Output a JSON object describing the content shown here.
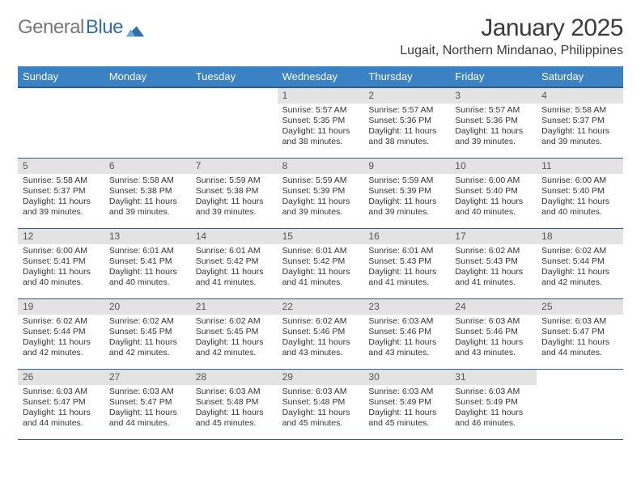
{
  "brand": {
    "general": "General",
    "blue": "Blue"
  },
  "title": "January 2025",
  "location": "Lugait, Northern Mindanao, Philippines",
  "weekdays": [
    "Sunday",
    "Monday",
    "Tuesday",
    "Wednesday",
    "Thursday",
    "Friday",
    "Saturday"
  ],
  "cells": [
    {
      "n": "",
      "s": "",
      "t": "",
      "d": ""
    },
    {
      "n": "",
      "s": "",
      "t": "",
      "d": ""
    },
    {
      "n": "",
      "s": "",
      "t": "",
      "d": ""
    },
    {
      "n": "1",
      "s": "Sunrise: 5:57 AM",
      "t": "Sunset: 5:35 PM",
      "d": "Daylight: 11 hours and 38 minutes."
    },
    {
      "n": "2",
      "s": "Sunrise: 5:57 AM",
      "t": "Sunset: 5:36 PM",
      "d": "Daylight: 11 hours and 38 minutes."
    },
    {
      "n": "3",
      "s": "Sunrise: 5:57 AM",
      "t": "Sunset: 5:36 PM",
      "d": "Daylight: 11 hours and 39 minutes."
    },
    {
      "n": "4",
      "s": "Sunrise: 5:58 AM",
      "t": "Sunset: 5:37 PM",
      "d": "Daylight: 11 hours and 39 minutes."
    },
    {
      "n": "5",
      "s": "Sunrise: 5:58 AM",
      "t": "Sunset: 5:37 PM",
      "d": "Daylight: 11 hours and 39 minutes."
    },
    {
      "n": "6",
      "s": "Sunrise: 5:58 AM",
      "t": "Sunset: 5:38 PM",
      "d": "Daylight: 11 hours and 39 minutes."
    },
    {
      "n": "7",
      "s": "Sunrise: 5:59 AM",
      "t": "Sunset: 5:38 PM",
      "d": "Daylight: 11 hours and 39 minutes."
    },
    {
      "n": "8",
      "s": "Sunrise: 5:59 AM",
      "t": "Sunset: 5:39 PM",
      "d": "Daylight: 11 hours and 39 minutes."
    },
    {
      "n": "9",
      "s": "Sunrise: 5:59 AM",
      "t": "Sunset: 5:39 PM",
      "d": "Daylight: 11 hours and 39 minutes."
    },
    {
      "n": "10",
      "s": "Sunrise: 6:00 AM",
      "t": "Sunset: 5:40 PM",
      "d": "Daylight: 11 hours and 40 minutes."
    },
    {
      "n": "11",
      "s": "Sunrise: 6:00 AM",
      "t": "Sunset: 5:40 PM",
      "d": "Daylight: 11 hours and 40 minutes."
    },
    {
      "n": "12",
      "s": "Sunrise: 6:00 AM",
      "t": "Sunset: 5:41 PM",
      "d": "Daylight: 11 hours and 40 minutes."
    },
    {
      "n": "13",
      "s": "Sunrise: 6:01 AM",
      "t": "Sunset: 5:41 PM",
      "d": "Daylight: 11 hours and 40 minutes."
    },
    {
      "n": "14",
      "s": "Sunrise: 6:01 AM",
      "t": "Sunset: 5:42 PM",
      "d": "Daylight: 11 hours and 41 minutes."
    },
    {
      "n": "15",
      "s": "Sunrise: 6:01 AM",
      "t": "Sunset: 5:42 PM",
      "d": "Daylight: 11 hours and 41 minutes."
    },
    {
      "n": "16",
      "s": "Sunrise: 6:01 AM",
      "t": "Sunset: 5:43 PM",
      "d": "Daylight: 11 hours and 41 minutes."
    },
    {
      "n": "17",
      "s": "Sunrise: 6:02 AM",
      "t": "Sunset: 5:43 PM",
      "d": "Daylight: 11 hours and 41 minutes."
    },
    {
      "n": "18",
      "s": "Sunrise: 6:02 AM",
      "t": "Sunset: 5:44 PM",
      "d": "Daylight: 11 hours and 42 minutes."
    },
    {
      "n": "19",
      "s": "Sunrise: 6:02 AM",
      "t": "Sunset: 5:44 PM",
      "d": "Daylight: 11 hours and 42 minutes."
    },
    {
      "n": "20",
      "s": "Sunrise: 6:02 AM",
      "t": "Sunset: 5:45 PM",
      "d": "Daylight: 11 hours and 42 minutes."
    },
    {
      "n": "21",
      "s": "Sunrise: 6:02 AM",
      "t": "Sunset: 5:45 PM",
      "d": "Daylight: 11 hours and 42 minutes."
    },
    {
      "n": "22",
      "s": "Sunrise: 6:02 AM",
      "t": "Sunset: 5:46 PM",
      "d": "Daylight: 11 hours and 43 minutes."
    },
    {
      "n": "23",
      "s": "Sunrise: 6:03 AM",
      "t": "Sunset: 5:46 PM",
      "d": "Daylight: 11 hours and 43 minutes."
    },
    {
      "n": "24",
      "s": "Sunrise: 6:03 AM",
      "t": "Sunset: 5:46 PM",
      "d": "Daylight: 11 hours and 43 minutes."
    },
    {
      "n": "25",
      "s": "Sunrise: 6:03 AM",
      "t": "Sunset: 5:47 PM",
      "d": "Daylight: 11 hours and 44 minutes."
    },
    {
      "n": "26",
      "s": "Sunrise: 6:03 AM",
      "t": "Sunset: 5:47 PM",
      "d": "Daylight: 11 hours and 44 minutes."
    },
    {
      "n": "27",
      "s": "Sunrise: 6:03 AM",
      "t": "Sunset: 5:47 PM",
      "d": "Daylight: 11 hours and 44 minutes."
    },
    {
      "n": "28",
      "s": "Sunrise: 6:03 AM",
      "t": "Sunset: 5:48 PM",
      "d": "Daylight: 11 hours and 45 minutes."
    },
    {
      "n": "29",
      "s": "Sunrise: 6:03 AM",
      "t": "Sunset: 5:48 PM",
      "d": "Daylight: 11 hours and 45 minutes."
    },
    {
      "n": "30",
      "s": "Sunrise: 6:03 AM",
      "t": "Sunset: 5:49 PM",
      "d": "Daylight: 11 hours and 45 minutes."
    },
    {
      "n": "31",
      "s": "Sunrise: 6:03 AM",
      "t": "Sunset: 5:49 PM",
      "d": "Daylight: 11 hours and 46 minutes."
    },
    {
      "n": "",
      "s": "",
      "t": "",
      "d": ""
    }
  ]
}
